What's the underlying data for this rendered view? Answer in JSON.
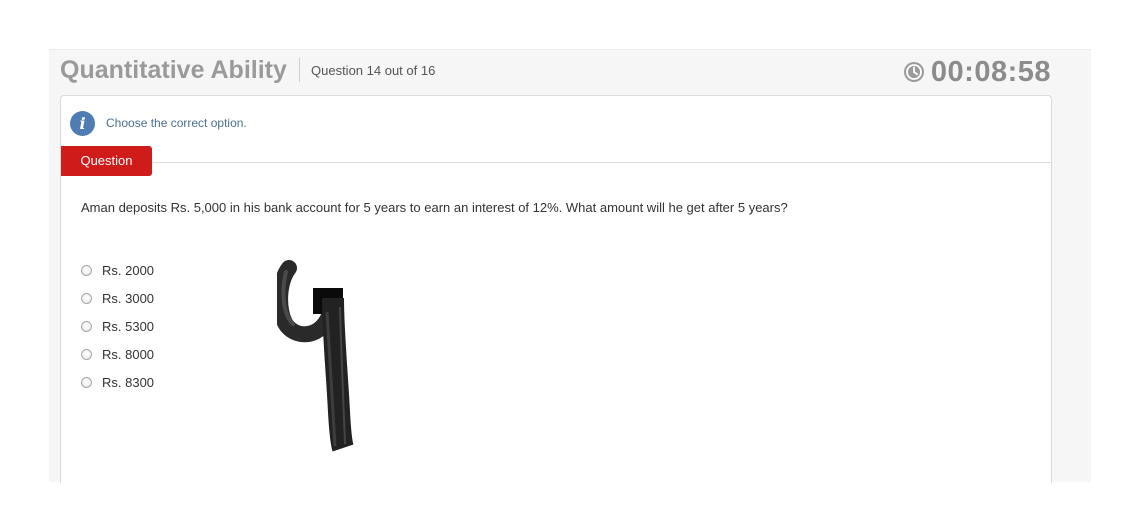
{
  "header": {
    "section_title": "Quantitative Ability",
    "question_counter": "Question 14 out of 16",
    "timer": "00:08:58",
    "timer_icon": "clock-icon"
  },
  "instruction": {
    "icon": "info-icon",
    "text": "Choose the correct option."
  },
  "question": {
    "tab_label": "Question",
    "text": "Aman deposits Rs. 5,000 in his bank account for 5 years to earn an interest of 12%. What amount will he get after 5 years?",
    "options": [
      {
        "label": "Rs. 2000",
        "selected": false
      },
      {
        "label": "Rs. 3000",
        "selected": false
      },
      {
        "label": "Rs. 5300",
        "selected": false
      },
      {
        "label": "Rs. 8000",
        "selected": false
      },
      {
        "label": "Rs. 8300",
        "selected": false
      }
    ]
  },
  "colors": {
    "tab_red": "#d01b1b",
    "info_blue": "#4f7db3",
    "title_gray": "#9a9a9a"
  }
}
